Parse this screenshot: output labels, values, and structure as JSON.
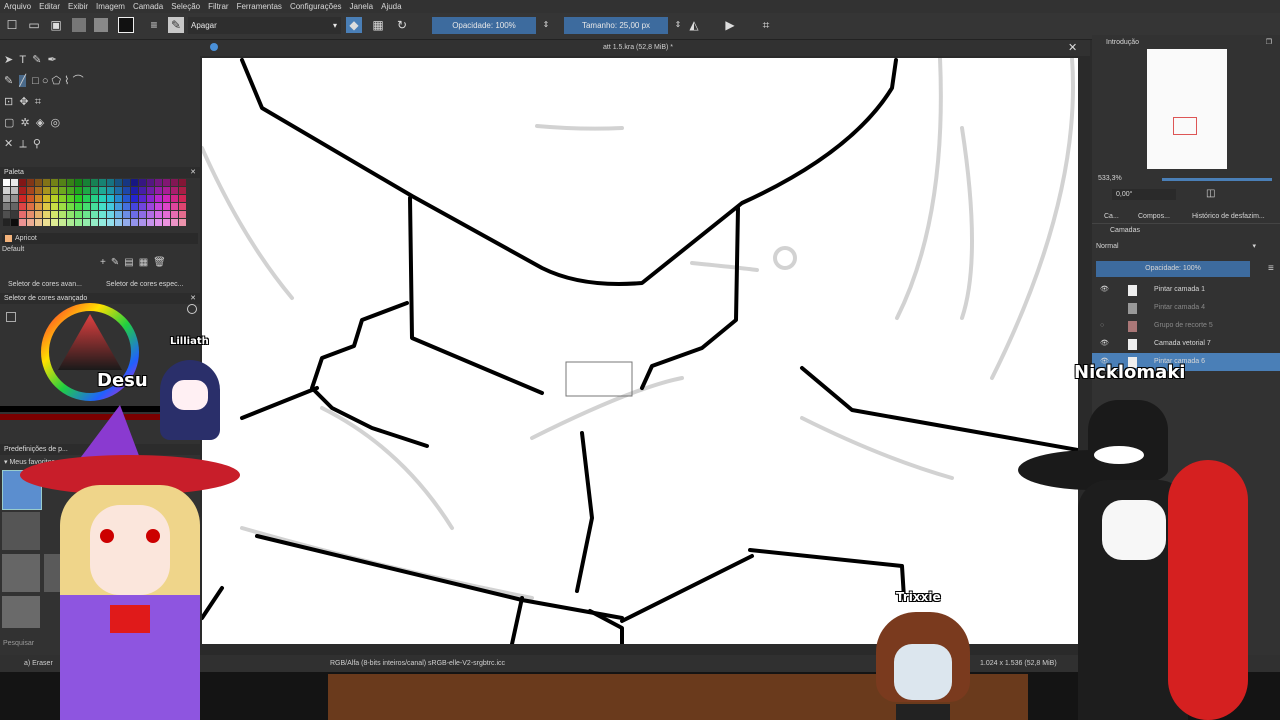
{
  "menu": [
    "Arquivo",
    "Editar",
    "Exibir",
    "Imagem",
    "Camada",
    "Seleção",
    "Filtrar",
    "Ferramentas",
    "Configurações",
    "Janela",
    "Ajuda"
  ],
  "toolbar": {
    "brush_preset": "Apagar",
    "opacity": "Opacidade: 100%",
    "size": "Tamanho: 25,00 px"
  },
  "document": {
    "tab_title": "att 1.5.kra (52,8 MiB) *"
  },
  "left": {
    "palette_title": "Paleta",
    "color_name": "Apricot",
    "palette_set": "Default",
    "advanced_tab1": "Seletor de cores avan...",
    "advanced_tab2": "Seletor de cores espec...",
    "advanced_title": "Seletor de cores avançado",
    "presets_title": "Predefinições de p...",
    "favorites": "Meus favoritos",
    "search": "Pesquisar"
  },
  "right": {
    "overview_title": "Introdução",
    "zoom": "533,3%",
    "rotation": "0,00°",
    "tab_ca": "Ca...",
    "tab_compos": "Compos...",
    "tab_history": "Histórico de desfazim...",
    "layers_title": "Camadas",
    "blend": "Normal",
    "opacity": "Opacidade:  100%",
    "layers": [
      {
        "name": "Pintar camada 1",
        "visible": true,
        "selected": false
      },
      {
        "name": "Pintar camada 4",
        "visible": false,
        "selected": false
      },
      {
        "name": "Grupo de recorte 5",
        "visible": false,
        "selected": false
      },
      {
        "name": "Camada vetorial 7",
        "visible": true,
        "selected": false
      },
      {
        "name": "Pintar camada 6",
        "visible": true,
        "selected": true
      }
    ]
  },
  "status": {
    "tool": "a) Eraser",
    "colorspace": "RGB/Alfa (8-bits inteiros/canal)  sRGB-elle-V2-srgbtrc.icc",
    "dims": "1.024 x 1.536 (52,8 MiB)"
  },
  "overlay": {
    "lilliath": "Lilliath",
    "desu": "Desu",
    "nicklomaki": "Nicklomaki",
    "trixxie": "Trixxie"
  },
  "colors": {
    "accent": "#3d6b9e",
    "selection": "#4a7fb7"
  }
}
